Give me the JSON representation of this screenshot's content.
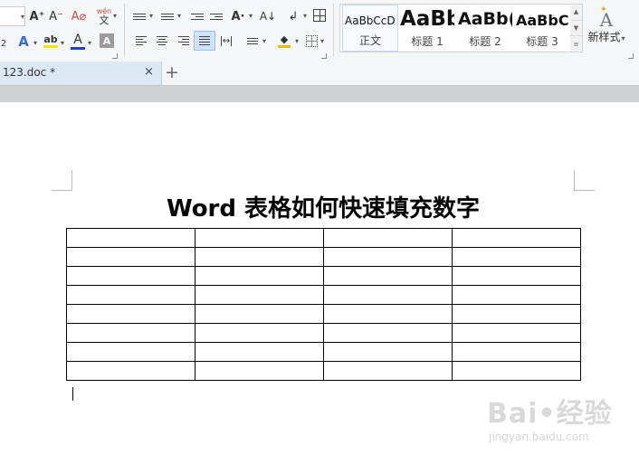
{
  "ribbon": {
    "font_size_value": "",
    "grow_font_glyph": "A⁺",
    "shrink_font_glyph": "A⁻",
    "clear_format_glyph": "A⌀",
    "phonetic_glyph_top": "wén",
    "phonetic_glyph_bottom": "文",
    "subscript_fragment": "2",
    "text_effect_glyph": "A",
    "highlight_glyph": "ab",
    "font_color_glyph": "A",
    "char_shading_glyph": "A",
    "sort_glyph": "A↓",
    "change_case_glyph": "A·",
    "font_color_hex": "#1f3fd1",
    "highlight_color_hex": "#f2e600",
    "fill_color_hex": "#e8c200",
    "styles": [
      {
        "sample": "AaBbCcDd",
        "name": "正文",
        "size": 12,
        "weight": "normal"
      },
      {
        "sample": "AaBb",
        "name": "标题 1",
        "size": 23,
        "weight": "bold"
      },
      {
        "sample": "AaBb(",
        "name": "标题 2",
        "size": 19,
        "weight": "bold"
      },
      {
        "sample": "AaBbC",
        "name": "标题 3",
        "size": 16,
        "weight": "bold"
      }
    ],
    "new_style_label": "新样式",
    "new_style_icon_glyph": "A"
  },
  "tabs": {
    "document_tab": "123.doc *",
    "close_glyph": "×",
    "new_tab_glyph": "+"
  },
  "document": {
    "title": "Word 表格如何快速填充数字",
    "table_rows": 8,
    "table_cols": 4
  },
  "watermark": {
    "brand": "Bai•经验",
    "url": "jingyan.baidu.com"
  }
}
